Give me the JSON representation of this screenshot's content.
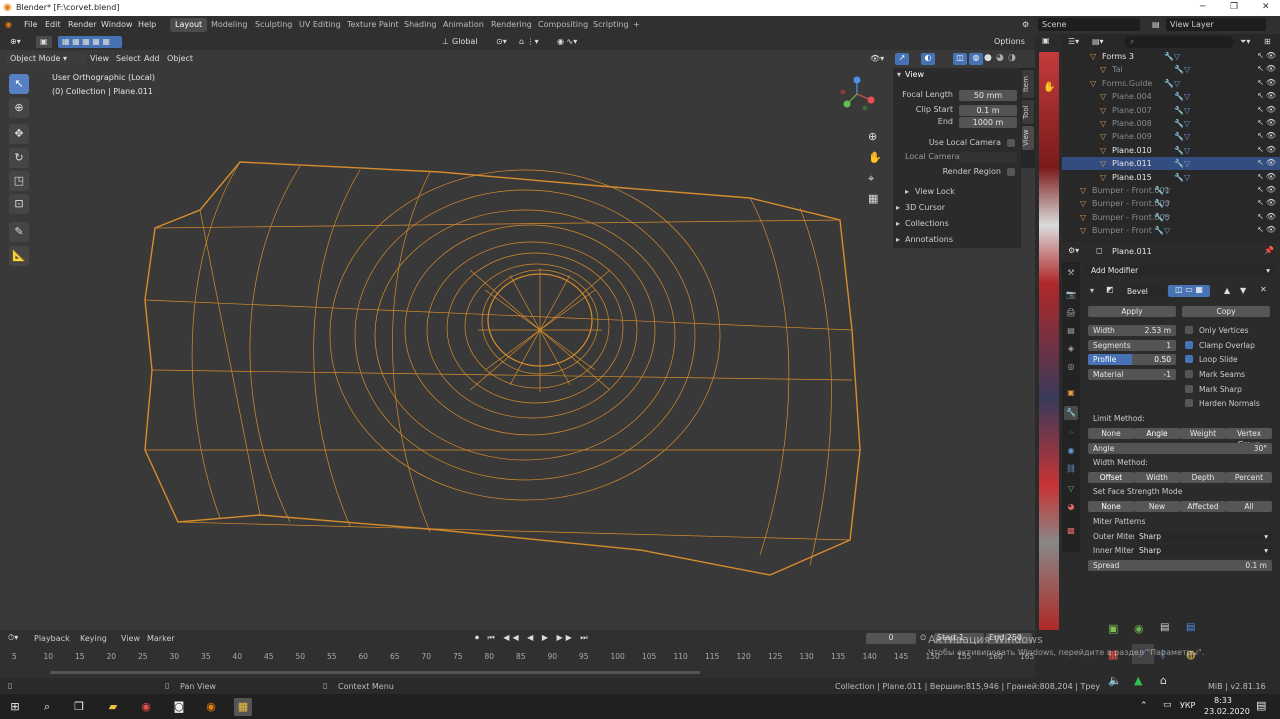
{
  "window": {
    "title": "Blender* [F:\\corvet.blend]"
  },
  "menu": {
    "items": [
      "File",
      "Edit",
      "Render",
      "Window",
      "Help"
    ]
  },
  "workspaces": [
    "Layout",
    "Modeling",
    "Sculpting",
    "UV Editing",
    "Texture Paint",
    "Shading",
    "Animation",
    "Rendering",
    "Compositing",
    "Scripting",
    "+"
  ],
  "scene": {
    "scene_name": "Scene",
    "view_layer": "View Layer"
  },
  "viewport": {
    "transform_orientation": "Global",
    "options_label": "Options",
    "mode": "Object Mode",
    "header_menus": [
      "View",
      "Select",
      "Add",
      "Object"
    ],
    "info_line1": "User Orthographic (Local)",
    "info_line2": "(0) Collection | Plane.011"
  },
  "npanel": {
    "section": "View",
    "focal_length_label": "Focal Length",
    "focal_length": "50 mm",
    "clip_start_label": "Clip Start",
    "clip_start": "0.1 m",
    "end_label": "End",
    "end": "1000 m",
    "use_local_camera": "Use Local Camera",
    "local_camera": "Local Camera",
    "render_region": "Render Region",
    "view_lock": "View Lock",
    "cursor3d": "3D Cursor",
    "collections": "Collections",
    "annotations": "Annotations",
    "tabs": [
      "Item",
      "Tool",
      "View"
    ]
  },
  "timeline": {
    "menus": [
      "Playback",
      "Keying",
      "View",
      "Marker"
    ],
    "current_frame": "0",
    "start_label": "Start",
    "start": "1",
    "end_label": "End",
    "end": "250",
    "ticks": [
      "5",
      "10",
      "15",
      "20",
      "25",
      "30",
      "35",
      "40",
      "45",
      "50",
      "55",
      "60",
      "65",
      "70",
      "75",
      "80",
      "85",
      "90",
      "95",
      "100",
      "105",
      "110",
      "115",
      "120",
      "125",
      "130",
      "135",
      "140",
      "145",
      "150",
      "155",
      "160",
      "165"
    ]
  },
  "statusbar": {
    "pan_view": "Pan View",
    "context_menu": "Context Menu",
    "stats": "Collection | Plane.011 | Вершин:815,946 | Граней:808,204 | Треуг.:1,616,67",
    "mem_version": "MiB | v2.81.16"
  },
  "outliner": {
    "search_placeholder": "",
    "rows": [
      {
        "label": "Forms 3",
        "dim": false,
        "sel": false,
        "indent": 2
      },
      {
        "label": "Tai",
        "dim": true,
        "sel": false,
        "indent": 3
      },
      {
        "label": "Forms.Guide",
        "dim": true,
        "sel": false,
        "indent": 2
      },
      {
        "label": "Plane.004",
        "dim": true,
        "sel": false,
        "indent": 3
      },
      {
        "label": "Plane.007",
        "dim": true,
        "sel": false,
        "indent": 3
      },
      {
        "label": "Plane.008",
        "dim": true,
        "sel": false,
        "indent": 3
      },
      {
        "label": "Plane.009",
        "dim": true,
        "sel": false,
        "indent": 3
      },
      {
        "label": "Plane.010",
        "dim": false,
        "sel": false,
        "indent": 3
      },
      {
        "label": "Plane.011",
        "dim": false,
        "sel": true,
        "indent": 3
      },
      {
        "label": "Plane.015",
        "dim": false,
        "sel": false,
        "indent": 3
      },
      {
        "label": "Bumper - Front.001",
        "dim": true,
        "sel": false,
        "indent": 1
      },
      {
        "label": "Bumper - Front.003",
        "dim": true,
        "sel": false,
        "indent": 1
      },
      {
        "label": "Bumper - Front.005",
        "dim": true,
        "sel": false,
        "indent": 1
      },
      {
        "label": "Bumper - Front",
        "dim": true,
        "sel": false,
        "indent": 1
      }
    ]
  },
  "properties": {
    "object_name": "Plane.011",
    "add_modifier": "Add Modifier",
    "modifier_name": "Bevel",
    "apply": "Apply",
    "copy": "Copy",
    "width_label": "Width",
    "width": "2.53 m",
    "segments_label": "Segments",
    "segments": "1",
    "profile_label": "Profile",
    "profile": "0.50",
    "material_label": "Material",
    "material": "-1",
    "only_vertices": "Only Vertices",
    "clamp_overlap": "Clamp Overlap",
    "loop_slide": "Loop Slide",
    "mark_seams": "Mark Seams",
    "mark_sharp": "Mark Sharp",
    "harden_normals": "Harden Normals",
    "limit_method_label": "Limit Method:",
    "limit_methods": [
      "None",
      "Angle",
      "Weight",
      "Vertex Group"
    ],
    "angle_label": "Angle",
    "angle": "30°",
    "width_method_label": "Width Method:",
    "width_methods": [
      "Offset",
      "Width",
      "Depth",
      "Percent"
    ],
    "face_strength_label": "Set Face Strength Mode",
    "face_strength": [
      "None",
      "New",
      "Affected",
      "All"
    ],
    "miter_patterns": "Miter Patterns",
    "outer_miter_label": "Outer Miter:",
    "outer_miter": "Sharp",
    "inner_miter_label": "Inner Miter:",
    "inner_miter": "Sharp",
    "spread_label": "Spread",
    "spread": "0.1 m"
  },
  "watermark": {
    "line1": "Активация Windows",
    "line2": "Чтобы активировать Windows, перейдите в раздел \"Параметры\"."
  },
  "taskbar": {
    "lang": "УКР",
    "time": "8:33",
    "date": "23.02.2020"
  },
  "colors": {
    "accent": "#4772b3",
    "wire": "#f0a030",
    "selected_row": "#334d80"
  }
}
